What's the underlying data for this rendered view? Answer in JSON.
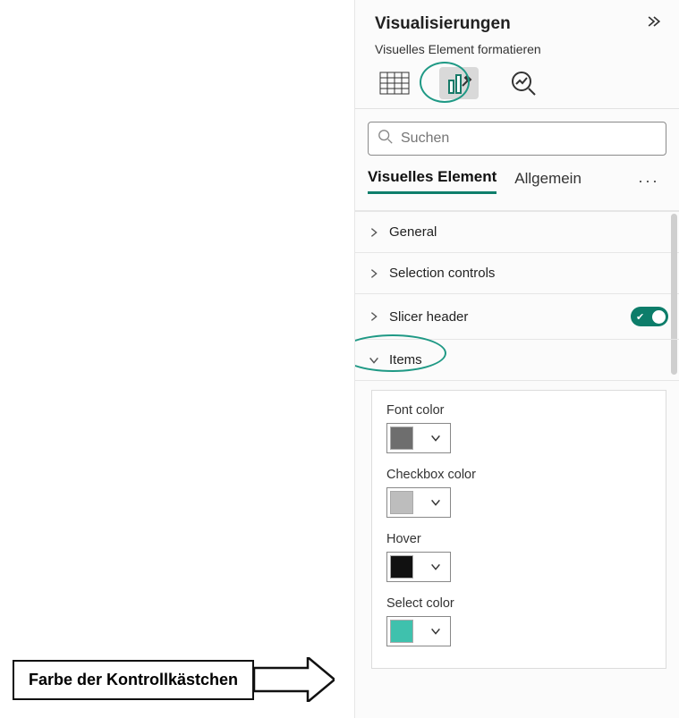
{
  "panel": {
    "title": "Visualisierungen",
    "subtitle": "Visuelles Element formatieren"
  },
  "search": {
    "placeholder": "Suchen"
  },
  "tabs": {
    "visual": "Visuelles Element",
    "general": "Allgemein",
    "more": "···"
  },
  "accordion": {
    "general": "General",
    "selection": "Selection controls",
    "slicer": "Slicer header",
    "items": "Items"
  },
  "items": {
    "fontColor": {
      "label": "Font color",
      "value": "#6e6e6e"
    },
    "checkboxColor": {
      "label": "Checkbox color",
      "value": "#bdbdbd"
    },
    "hover": {
      "label": "Hover",
      "value": "#111111"
    },
    "selectColor": {
      "label": "Select color",
      "value": "#3fc1ad"
    }
  },
  "callout": {
    "label": "Farbe der Kontrollkästchen"
  }
}
